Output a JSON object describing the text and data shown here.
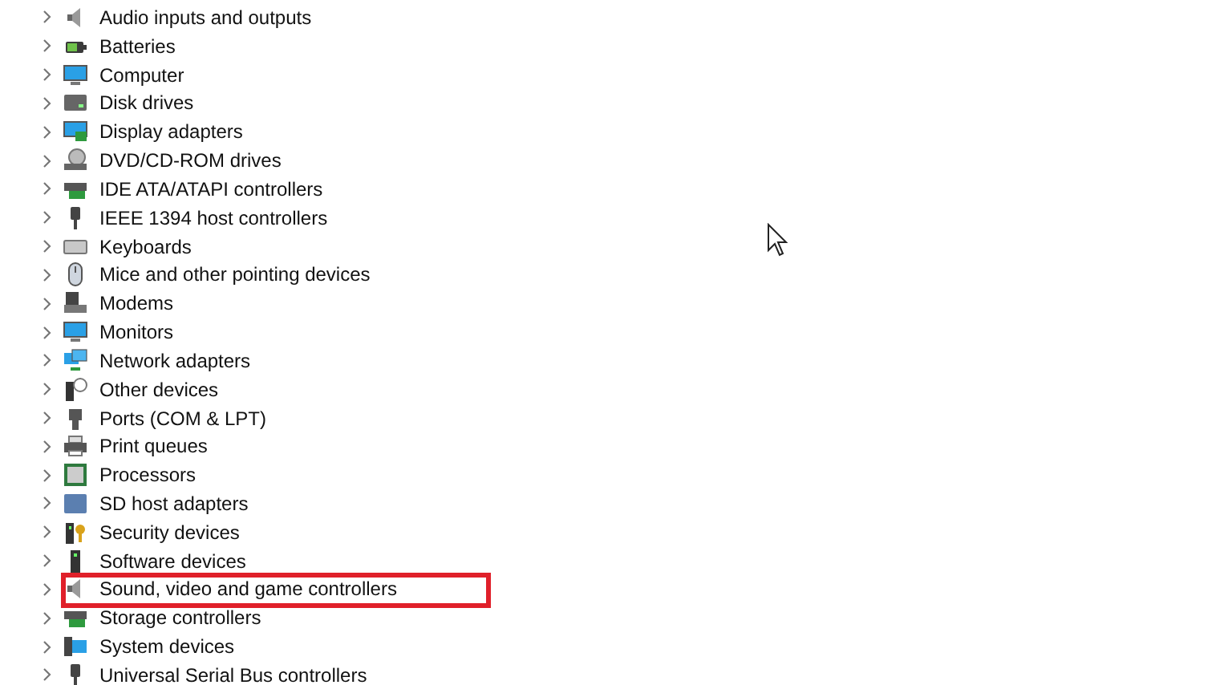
{
  "tree": {
    "items": [
      {
        "label": "Audio inputs and outputs",
        "expanded": false,
        "highlighted": false
      },
      {
        "label": "Batteries",
        "expanded": false,
        "highlighted": false
      },
      {
        "label": "Computer",
        "expanded": false,
        "highlighted": false
      },
      {
        "label": "Disk drives",
        "expanded": false,
        "highlighted": false
      },
      {
        "label": "Display adapters",
        "expanded": false,
        "highlighted": false
      },
      {
        "label": "DVD/CD-ROM drives",
        "expanded": false,
        "highlighted": false
      },
      {
        "label": "IDE ATA/ATAPI controllers",
        "expanded": false,
        "highlighted": false
      },
      {
        "label": "IEEE 1394 host controllers",
        "expanded": false,
        "highlighted": false
      },
      {
        "label": "Keyboards",
        "expanded": false,
        "highlighted": false
      },
      {
        "label": "Mice and other pointing devices",
        "expanded": false,
        "highlighted": false
      },
      {
        "label": "Modems",
        "expanded": false,
        "highlighted": false
      },
      {
        "label": "Monitors",
        "expanded": false,
        "highlighted": false
      },
      {
        "label": "Network adapters",
        "expanded": false,
        "highlighted": false
      },
      {
        "label": "Other devices",
        "expanded": false,
        "highlighted": false
      },
      {
        "label": "Ports (COM & LPT)",
        "expanded": false,
        "highlighted": false
      },
      {
        "label": "Print queues",
        "expanded": false,
        "highlighted": false
      },
      {
        "label": "Processors",
        "expanded": false,
        "highlighted": false
      },
      {
        "label": "SD host adapters",
        "expanded": false,
        "highlighted": false
      },
      {
        "label": "Security devices",
        "expanded": false,
        "highlighted": false
      },
      {
        "label": "Software devices",
        "expanded": false,
        "highlighted": false
      },
      {
        "label": "Sound, video and game controllers",
        "expanded": false,
        "highlighted": true
      },
      {
        "label": "Storage controllers",
        "expanded": false,
        "highlighted": false
      },
      {
        "label": "System devices",
        "expanded": false,
        "highlighted": false
      },
      {
        "label": "Universal Serial Bus controllers",
        "expanded": false,
        "highlighted": false
      }
    ]
  }
}
